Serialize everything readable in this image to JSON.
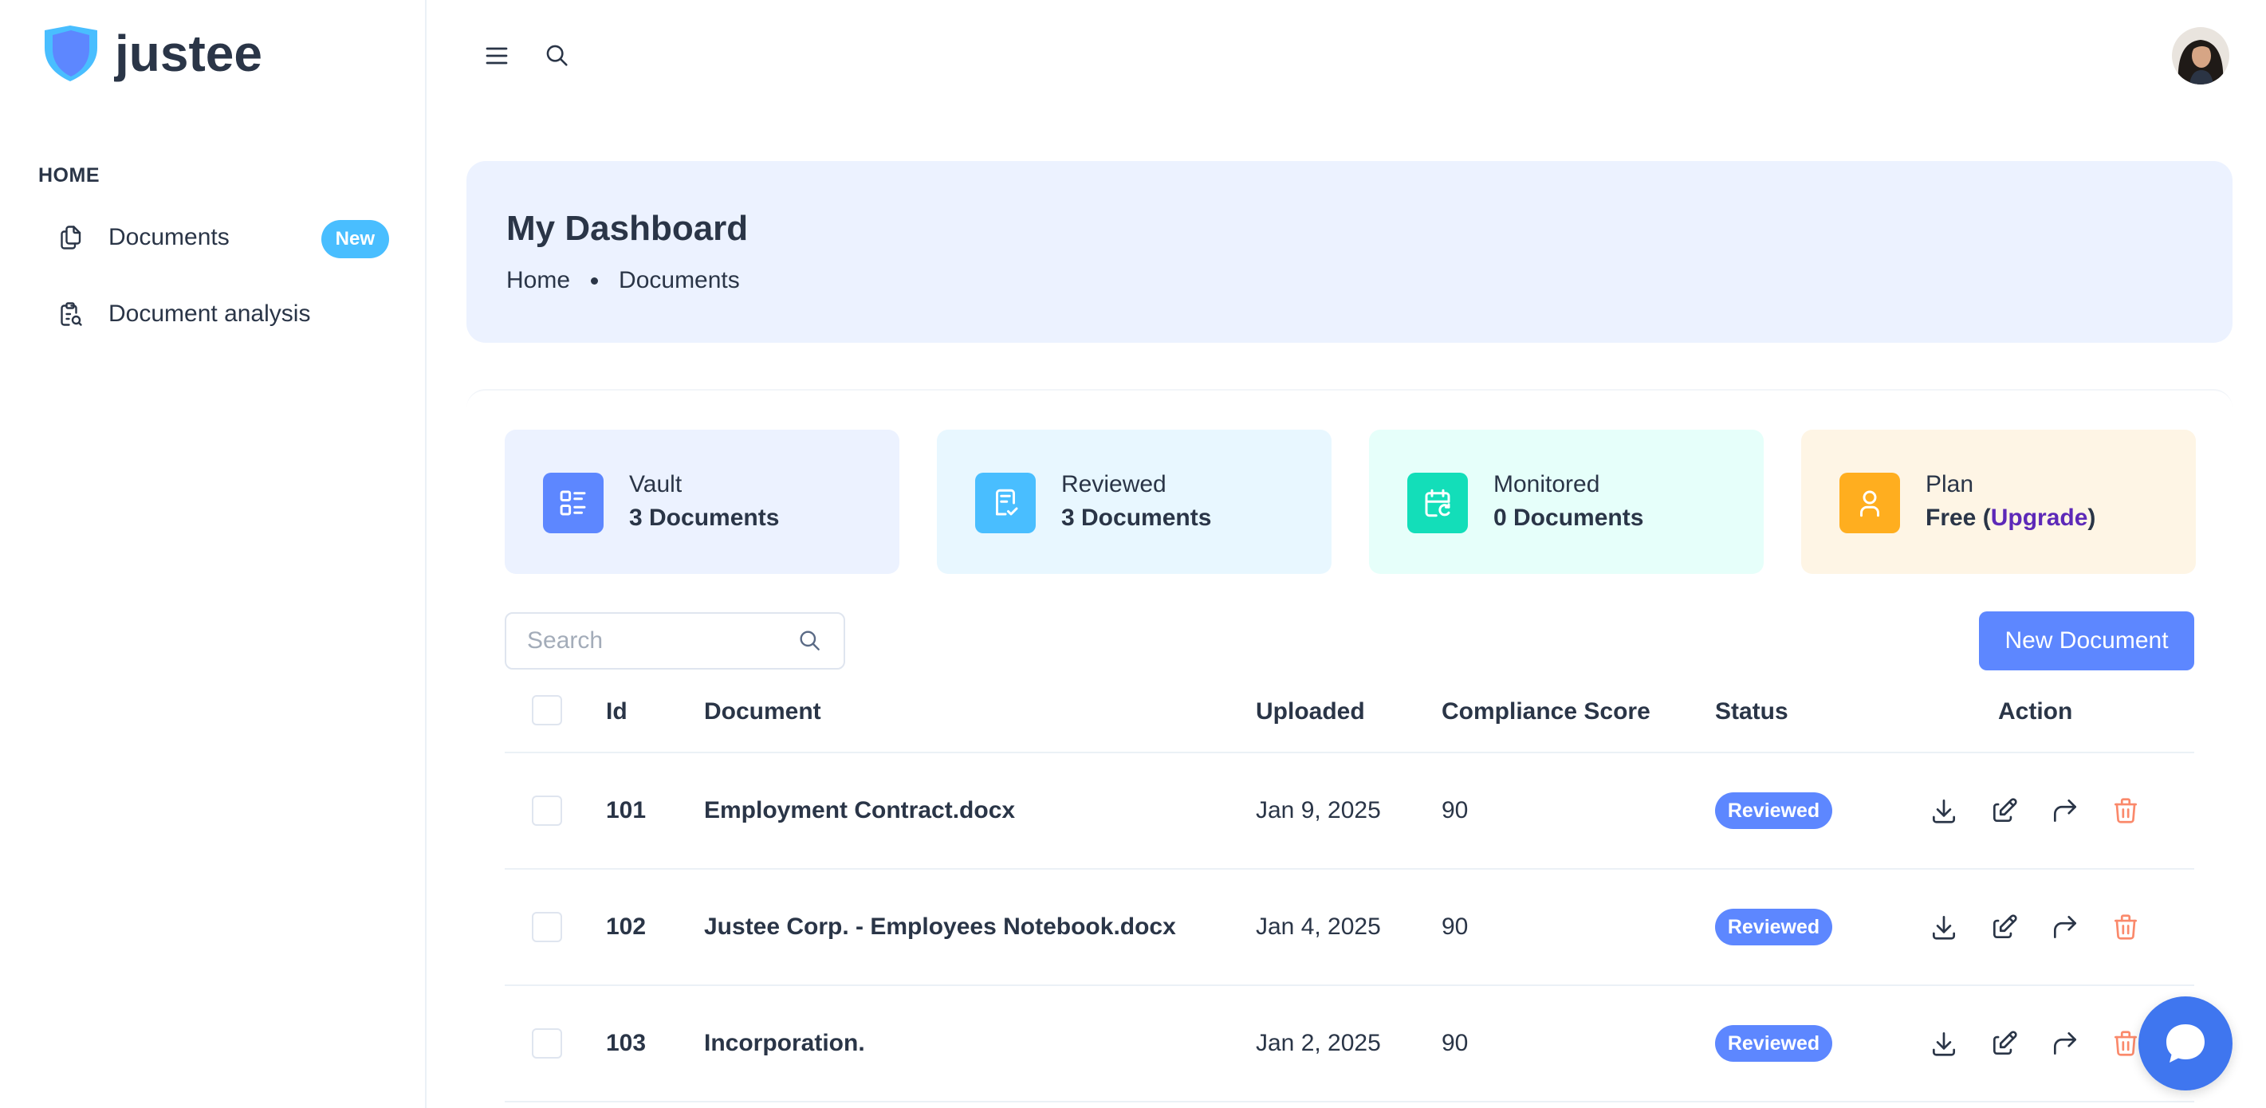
{
  "brand": {
    "name": "justee"
  },
  "sidebar": {
    "section": "HOME",
    "items": [
      {
        "label": "Documents",
        "badge": "New",
        "icon": "documents-icon"
      },
      {
        "label": "Document analysis",
        "icon": "document-analysis-icon"
      }
    ]
  },
  "topbar": {
    "menu_icon": "hamburger-icon",
    "search_icon": "search-icon",
    "avatar": "user-avatar"
  },
  "header": {
    "title": "My Dashboard",
    "breadcrumb": [
      "Home",
      "Documents"
    ]
  },
  "stats": [
    {
      "label": "Vault",
      "value": "3 Documents",
      "color": "#ecf2ff",
      "icon_bg": "#5d87ff",
      "icon": "list-icon"
    },
    {
      "label": "Reviewed",
      "value": "3 Documents",
      "color": "#e8f7ff",
      "icon_bg": "#49beff",
      "icon": "document-check-icon"
    },
    {
      "label": "Monitored",
      "value": "0 Documents",
      "color": "#e6fffa",
      "icon_bg": "#13deb9",
      "icon": "calendar-refresh-icon"
    },
    {
      "label": "Plan",
      "value_prefix": "Free (",
      "value_link": "Upgrade",
      "value_suffix": ")",
      "color": "#fef5e5",
      "icon_bg": "#ffae1f",
      "icon": "user-icon"
    }
  ],
  "search": {
    "placeholder": "Search"
  },
  "new_document_label": "New Document",
  "table": {
    "headers": {
      "id": "Id",
      "document": "Document",
      "uploaded": "Uploaded",
      "score": "Compliance Score",
      "status": "Status",
      "action": "Action"
    },
    "rows": [
      {
        "id": "101",
        "document": "Employment Contract.docx",
        "uploaded": "Jan 9, 2025",
        "score": "90",
        "status": "Reviewed"
      },
      {
        "id": "102",
        "document": "Justee Corp. - Employees Notebook.docx",
        "uploaded": "Jan 4, 2025",
        "score": "90",
        "status": "Reviewed"
      },
      {
        "id": "103",
        "document": "Incorporation.",
        "uploaded": "Jan 2, 2025",
        "score": "90",
        "status": "Reviewed"
      }
    ]
  },
  "colors": {
    "primary": "#5d87ff",
    "danger": "#fa896b",
    "text": "#2a3547"
  }
}
